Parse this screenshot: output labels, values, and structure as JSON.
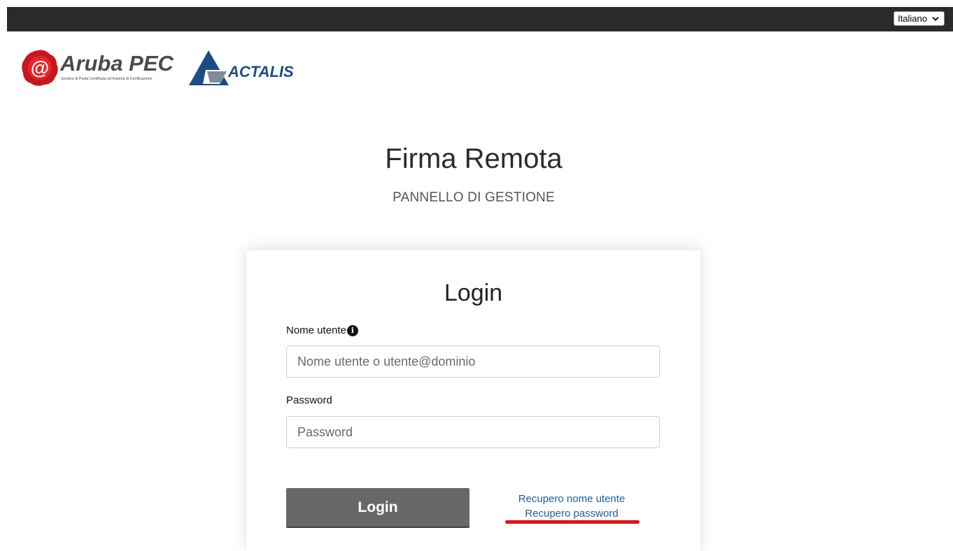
{
  "header": {
    "language": {
      "selected": "Italiano"
    }
  },
  "logos": {
    "aruba": {
      "text": "Aruba PEC",
      "tagline": "Gestore di Posta Certificata ed Autorità di Certificazione",
      "color": "#d0191f"
    },
    "actalis": {
      "text": "ACTALIS",
      "color": "#1d4c86"
    }
  },
  "page": {
    "title": "Firma Remota",
    "subtitle": "PANNELLO DI GESTIONE"
  },
  "login": {
    "title": "Login",
    "username": {
      "label": "Nome utente",
      "info_icon": "i",
      "placeholder": "Nome utente o utente@dominio",
      "value": ""
    },
    "password": {
      "label": "Password",
      "placeholder": "Password",
      "value": ""
    },
    "submit_label": "Login",
    "links": {
      "recover_username": "Recupero nome utente",
      "recover_password": "Recupero password"
    }
  },
  "colors": {
    "topbar": "#2a2a2a",
    "button": "#686868",
    "link": "#1f5ea8",
    "highlight": "#e01010"
  }
}
